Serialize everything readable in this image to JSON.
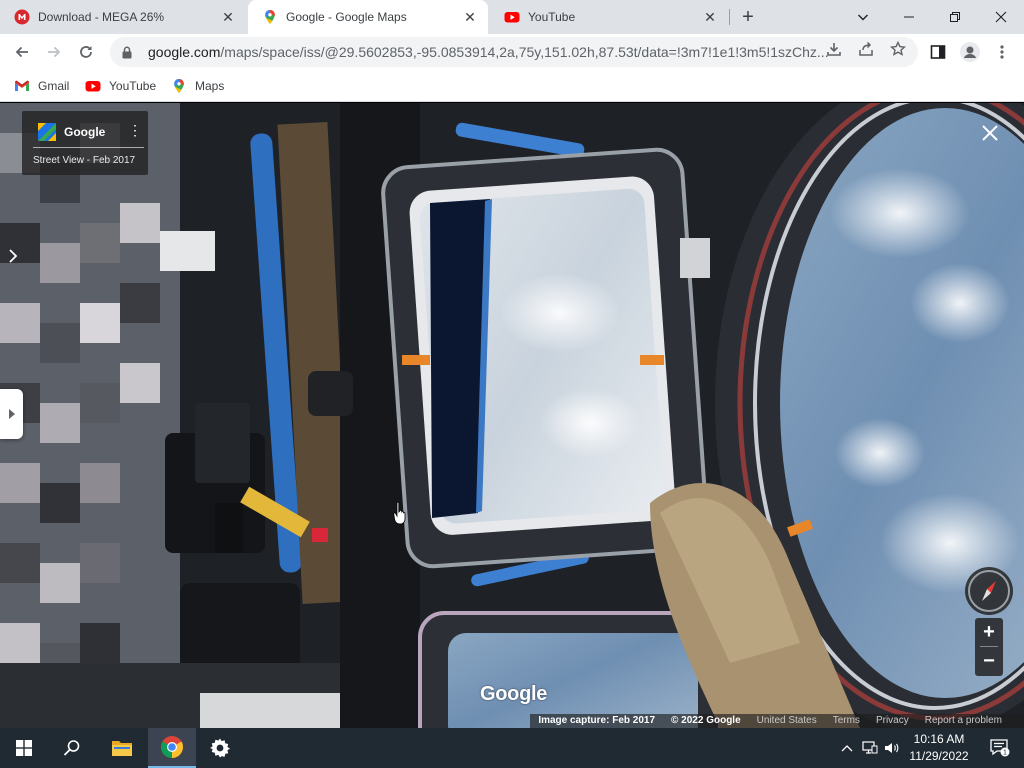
{
  "browser": {
    "tabs": [
      {
        "title": "Download - MEGA 26%",
        "favicon": "mega-icon",
        "active": false
      },
      {
        "title": "Google - Google Maps",
        "favicon": "google-maps-icon",
        "active": true
      },
      {
        "title": "YouTube",
        "favicon": "youtube-icon",
        "active": false
      }
    ],
    "new_tab_symbol": "+",
    "address": {
      "host": "google.com",
      "path": "/maps/space/iss/@29.5602853,-95.0853914,2a,75y,151.02h,87.53t/data=!3m7!1e1!3m5!1szChz..."
    },
    "bookmarks": [
      {
        "label": "Gmail",
        "icon": "gmail-icon"
      },
      {
        "label": "YouTube",
        "icon": "youtube-icon"
      },
      {
        "label": "Maps",
        "icon": "google-maps-icon"
      }
    ]
  },
  "streetview": {
    "brand": "Google",
    "date_label": "Street View - Feb 2017",
    "watermark": "Google",
    "attribution": {
      "capture": "Image capture: Feb 2017",
      "copyright": "© 2022 Google",
      "region": "United States",
      "terms": "Terms",
      "privacy": "Privacy",
      "report": "Report a problem"
    },
    "zoom_in": "+",
    "zoom_out": "−"
  },
  "taskbar": {
    "time": "10:16 AM",
    "date": "11/29/2022",
    "notification_count": "1",
    "accent": "#76b9ed"
  }
}
